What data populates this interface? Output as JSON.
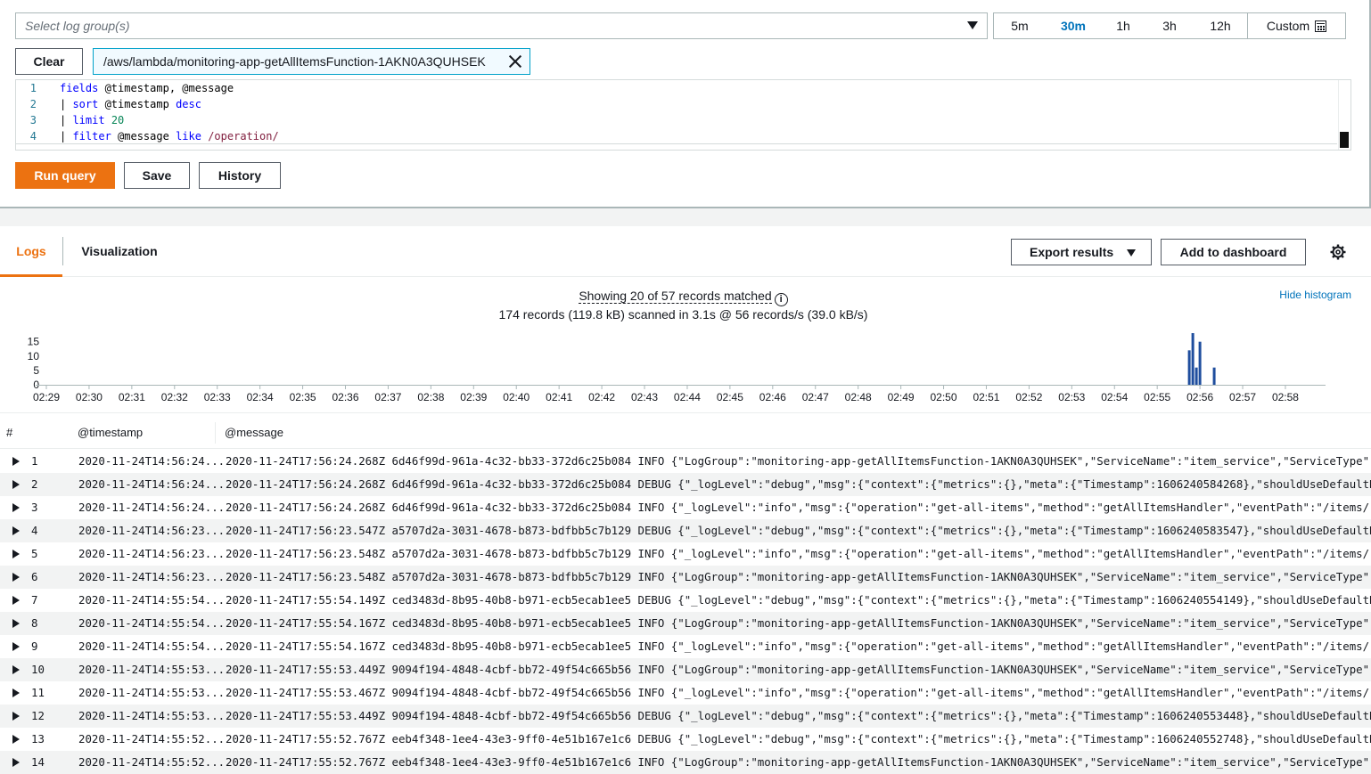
{
  "query": {
    "log_group_placeholder": "Select log group(s)",
    "time_ranges": [
      "5m",
      "30m",
      "1h",
      "3h",
      "12h"
    ],
    "time_range_active": "30m",
    "custom_label": "Custom",
    "clear_label": "Clear",
    "selected_group": "/aws/lambda/monitoring-app-getAllItemsFunction-1AKN0A3QUHSEK",
    "editor_lines": [
      {
        "num": "1",
        "code": "fields @timestamp, @message"
      },
      {
        "num": "2",
        "code": "| sort @timestamp desc"
      },
      {
        "num": "3",
        "code": "| limit 20"
      },
      {
        "num": "4",
        "code": "| filter @message like /operation/"
      }
    ],
    "run_label": "Run query",
    "save_label": "Save",
    "history_label": "History"
  },
  "results": {
    "tabs": [
      "Logs",
      "Visualization"
    ],
    "export_label": "Export results",
    "dashboard_label": "Add to dashboard",
    "summary_line1": "Showing 20 of 57 records matched",
    "summary_line2": "174 records (119.8 kB) scanned in 3.1s @ 56 records/s (39.0 kB/s)",
    "hide_histogram": "Hide histogram"
  },
  "chart_data": {
    "type": "bar",
    "y_ticks": [
      "15",
      "10",
      "5",
      "0"
    ],
    "ylim": [
      0,
      18
    ],
    "x_ticks": [
      "02:29",
      "02:30",
      "02:31",
      "02:32",
      "02:33",
      "02:34",
      "02:35",
      "02:36",
      "02:37",
      "02:38",
      "02:39",
      "02:40",
      "02:41",
      "02:42",
      "02:43",
      "02:44",
      "02:45",
      "02:46",
      "02:47",
      "02:48",
      "02:49",
      "02:50",
      "02:51",
      "02:52",
      "02:53",
      "02:54",
      "02:55",
      "02:56",
      "02:57",
      "02:58"
    ],
    "bars": [
      {
        "x": "02:55:45",
        "value": 12
      },
      {
        "x": "02:55:50",
        "value": 18
      },
      {
        "x": "02:55:55",
        "value": 6
      },
      {
        "x": "02:56:00",
        "value": 15
      },
      {
        "x": "02:56:20",
        "value": 6
      }
    ],
    "color": "#1f4e9e"
  },
  "table": {
    "headers": [
      "#",
      "@timestamp",
      "@message"
    ],
    "rows": [
      {
        "idx": "1",
        "ts": "2020-11-24T14:56:24...",
        "msg": "2020-11-24T17:56:24.268Z 6d46f99d-961a-4c32-bb33-372d6c25b084 INFO {\"LogGroup\":\"monitoring-app-getAllItemsFunction-1AKN0A3QUHSEK\",\"ServiceName\":\"item_service\",\"ServiceType\":\"AWS:"
      },
      {
        "idx": "2",
        "ts": "2020-11-24T14:56:24...",
        "msg": "2020-11-24T17:56:24.268Z 6d46f99d-961a-4c32-bb33-372d6c25b084 DEBUG {\"_logLevel\":\"debug\",\"msg\":{\"context\":{\"metrics\":{},\"meta\":{\"Timestamp\":1606240584268},\"shouldUseDefaultDimens"
      },
      {
        "idx": "3",
        "ts": "2020-11-24T14:56:24...",
        "msg": "2020-11-24T17:56:24.268Z 6d46f99d-961a-4c32-bb33-372d6c25b084 INFO {\"_logLevel\":\"info\",\"msg\":{\"operation\":\"get-all-items\",\"method\":\"getAllItemsHandler\",\"eventPath\":\"/items/\",\"sta"
      },
      {
        "idx": "4",
        "ts": "2020-11-24T14:56:23...",
        "msg": "2020-11-24T17:56:23.547Z a5707d2a-3031-4678-b873-bdfbb5c7b129 DEBUG {\"_logLevel\":\"debug\",\"msg\":{\"context\":{\"metrics\":{},\"meta\":{\"Timestamp\":1606240583547},\"shouldUseDefaultDimens"
      },
      {
        "idx": "5",
        "ts": "2020-11-24T14:56:23...",
        "msg": "2020-11-24T17:56:23.548Z a5707d2a-3031-4678-b873-bdfbb5c7b129 INFO {\"_logLevel\":\"info\",\"msg\":{\"operation\":\"get-all-items\",\"method\":\"getAllItemsHandler\",\"eventPath\":\"/items/\",\"sta"
      },
      {
        "idx": "6",
        "ts": "2020-11-24T14:56:23...",
        "msg": "2020-11-24T17:56:23.548Z a5707d2a-3031-4678-b873-bdfbb5c7b129 INFO {\"LogGroup\":\"monitoring-app-getAllItemsFunction-1AKN0A3QUHSEK\",\"ServiceName\":\"item_service\",\"ServiceType\":\"AWS:"
      },
      {
        "idx": "7",
        "ts": "2020-11-24T14:55:54...",
        "msg": "2020-11-24T17:55:54.149Z ced3483d-8b95-40b8-b971-ecb5ecab1ee5 DEBUG {\"_logLevel\":\"debug\",\"msg\":{\"context\":{\"metrics\":{},\"meta\":{\"Timestamp\":1606240554149},\"shouldUseDefaultDimens"
      },
      {
        "idx": "8",
        "ts": "2020-11-24T14:55:54...",
        "msg": "2020-11-24T17:55:54.167Z ced3483d-8b95-40b8-b971-ecb5ecab1ee5 INFO {\"LogGroup\":\"monitoring-app-getAllItemsFunction-1AKN0A3QUHSEK\",\"ServiceName\":\"item_service\",\"ServiceType\":\"AWS:"
      },
      {
        "idx": "9",
        "ts": "2020-11-24T14:55:54...",
        "msg": "2020-11-24T17:55:54.167Z ced3483d-8b95-40b8-b971-ecb5ecab1ee5 INFO {\"_logLevel\":\"info\",\"msg\":{\"operation\":\"get-all-items\",\"method\":\"getAllItemsHandler\",\"eventPath\":\"/items/\",\"sta"
      },
      {
        "idx": "10",
        "ts": "2020-11-24T14:55:53...",
        "msg": "2020-11-24T17:55:53.449Z 9094f194-4848-4cbf-bb72-49f54c665b56 INFO {\"LogGroup\":\"monitoring-app-getAllItemsFunction-1AKN0A3QUHSEK\",\"ServiceName\":\"item_service\",\"ServiceType\":\"AWS:"
      },
      {
        "idx": "11",
        "ts": "2020-11-24T14:55:53...",
        "msg": "2020-11-24T17:55:53.467Z 9094f194-4848-4cbf-bb72-49f54c665b56 INFO {\"_logLevel\":\"info\",\"msg\":{\"operation\":\"get-all-items\",\"method\":\"getAllItemsHandler\",\"eventPath\":\"/items/\",\"sta"
      },
      {
        "idx": "12",
        "ts": "2020-11-24T14:55:53...",
        "msg": "2020-11-24T17:55:53.449Z 9094f194-4848-4cbf-bb72-49f54c665b56 DEBUG {\"_logLevel\":\"debug\",\"msg\":{\"context\":{\"metrics\":{},\"meta\":{\"Timestamp\":1606240553448},\"shouldUseDefaultDimens"
      },
      {
        "idx": "13",
        "ts": "2020-11-24T14:55:52...",
        "msg": "2020-11-24T17:55:52.767Z eeb4f348-1ee4-43e3-9ff0-4e51b167e1c6 DEBUG {\"_logLevel\":\"debug\",\"msg\":{\"context\":{\"metrics\":{},\"meta\":{\"Timestamp\":1606240552748},\"shouldUseDefaultDimens"
      },
      {
        "idx": "14",
        "ts": "2020-11-24T14:55:52...",
        "msg": "2020-11-24T17:55:52.767Z eeb4f348-1ee4-43e3-9ff0-4e51b167e1c6 INFO {\"LogGroup\":\"monitoring-app-getAllItemsFunction-1AKN0A3QUHSEK\",\"ServiceName\":\"item_service\",\"ServiceType\":\"AWS:"
      }
    ]
  }
}
